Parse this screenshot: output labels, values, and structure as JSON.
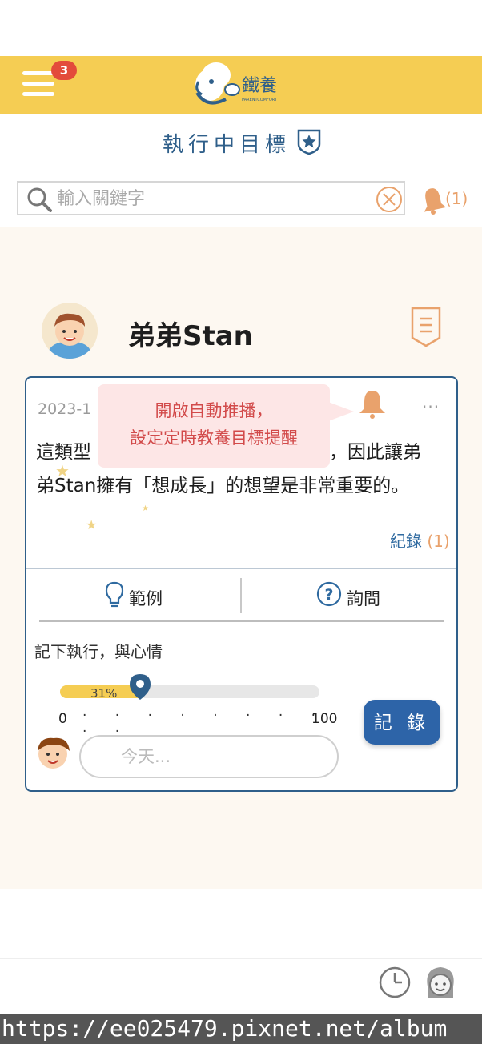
{
  "header": {
    "menu_badge": "3",
    "logo_text": "鐵養",
    "logo_subtext": "PARENTCOMFORT"
  },
  "titlebar": {
    "title": "執行中目標"
  },
  "search": {
    "placeholder": "輸入關鍵字",
    "notification_count": "(1)"
  },
  "profile": {
    "name": "弟弟Stan"
  },
  "card": {
    "date": "2023-1",
    "more": "···",
    "text_line1_start": "這類型",
    "text_line1_end": "圈，因此讓弟",
    "text_line2": "弟Stan擁有「想成長」的想望是非常重要的。",
    "tooltip_line1": "開啟自動推播，",
    "tooltip_line2": "設定定時教養目標提醒",
    "record_link": "紀錄",
    "record_count": "(1)",
    "example_label": "範例",
    "ask_label": "詢問",
    "mood_label": "記下執行，與心情",
    "progress_percent": 31,
    "progress_label": "31%",
    "scale_min": "0",
    "scale_dots": "· · · · · · · · · ·",
    "scale_max": "100",
    "record_button": "記 錄",
    "note_placeholder": "今天..."
  },
  "url": "https://ee025479.pixnet.net/album",
  "colors": {
    "header_yellow": "#f5cd53",
    "primary_blue": "#2f5f8a",
    "button_blue": "#2d64a8",
    "accent_orange": "#e9a26c",
    "tooltip_pink": "#fde6e6",
    "tooltip_red": "#d24a4a",
    "badge_red": "#e34b3b",
    "main_bg": "#fdf8f1"
  }
}
